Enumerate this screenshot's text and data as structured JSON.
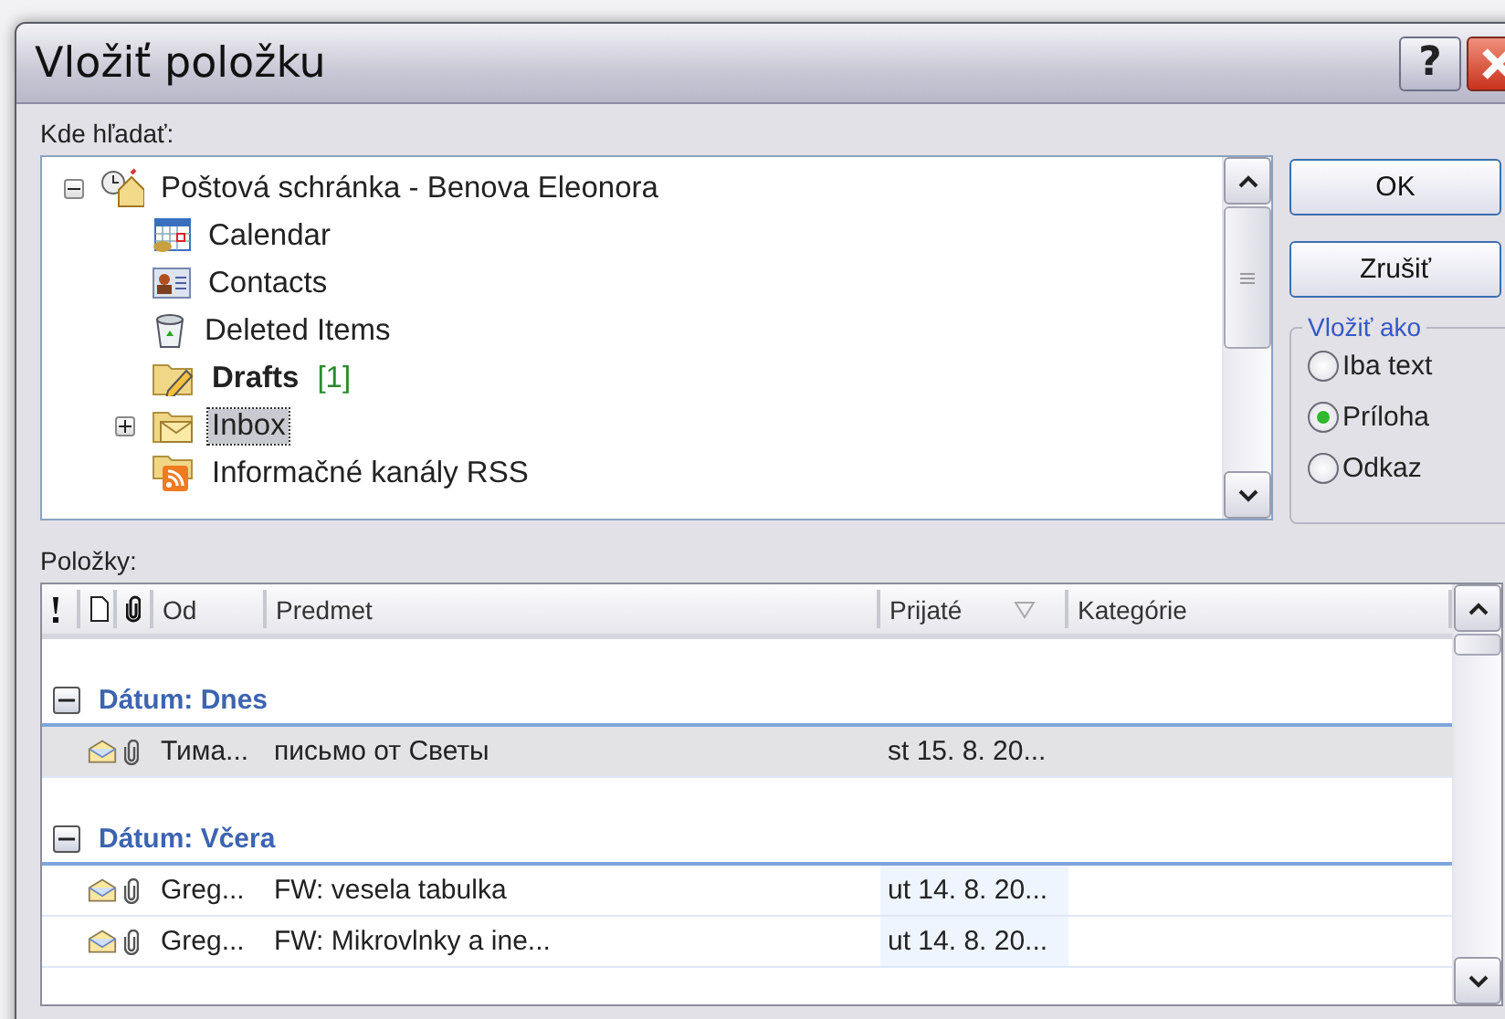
{
  "window": {
    "title": "Vložiť položku",
    "help_button": "?"
  },
  "folders": {
    "label": "Kde hľadať:",
    "tree": [
      {
        "name": "Poštová schránka - Benova Eleonora",
        "kind": "mailbox",
        "expanded": true,
        "selected": false,
        "children": [
          {
            "name": "Calendar",
            "kind": "calendar",
            "selected": false
          },
          {
            "name": "Contacts",
            "kind": "contacts",
            "selected": false
          },
          {
            "name": "Deleted Items",
            "kind": "trash",
            "selected": false
          },
          {
            "name": "Drafts",
            "kind": "drafts",
            "unread": "[1]",
            "selected": false
          },
          {
            "name": "Inbox",
            "kind": "inbox",
            "expanded": false,
            "selected": true
          },
          {
            "name": "Informačné kanály RSS",
            "kind": "rss",
            "selected": false
          }
        ]
      }
    ]
  },
  "buttons": [
    "OK",
    "Zrušiť"
  ],
  "paste_as": {
    "legend": "Vložiť ako",
    "options": [
      {
        "label": "Iba text",
        "selected": false
      },
      {
        "label": "Príloha",
        "selected": true
      },
      {
        "label": "Odkaz",
        "selected": false
      }
    ]
  },
  "items": {
    "label": "Položky:",
    "columns": [
      {
        "kind": "importance",
        "sorted": false
      },
      {
        "kind": "type",
        "sorted": false
      },
      {
        "kind": "attachment",
        "sorted": false
      },
      {
        "kind": "text",
        "label": "Od",
        "sorted": false
      },
      {
        "kind": "text",
        "label": "Predmet",
        "sorted": false
      },
      {
        "kind": "text",
        "label": "Prijaté",
        "sorted": true
      },
      {
        "kind": "text",
        "label": "Kategórie",
        "sorted": false
      }
    ],
    "groups": [
      {
        "label": "Dátum: Dnes",
        "expanded": true,
        "rows": [
          {
            "from": "Тима...",
            "subject": "письмо от Светы",
            "received": "st 15. 8. 20...",
            "attachment": true,
            "selected": true
          }
        ]
      },
      {
        "label": "Dátum: Včera",
        "expanded": true,
        "rows": [
          {
            "from": "Greg...",
            "subject": "FW: vesela tabulka",
            "received": "ut 14. 8. 20...",
            "attachment": true,
            "selected": false
          },
          {
            "from": "Greg...",
            "subject": "FW: Mikrovlnky a ine...",
            "received": "ut 14. 8. 20...",
            "attachment": true,
            "selected": false
          }
        ]
      }
    ]
  }
}
